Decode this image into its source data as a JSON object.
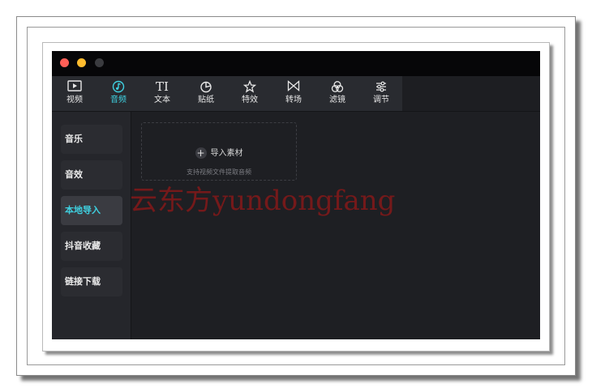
{
  "window": {
    "traffic_lights": [
      {
        "name": "close",
        "color": "#ff5f57"
      },
      {
        "name": "minimize",
        "color": "#febc2e"
      },
      {
        "name": "zoom",
        "color": "#3a3b3f"
      }
    ]
  },
  "toolbar": {
    "items": [
      {
        "label": "视频",
        "icon": "play-box-icon",
        "active": false
      },
      {
        "label": "音频",
        "icon": "music-note-icon",
        "active": true
      },
      {
        "label": "文本",
        "icon": "text-ti-icon",
        "active": false
      },
      {
        "label": "贴纸",
        "icon": "sticker-icon",
        "active": false
      },
      {
        "label": "特效",
        "icon": "sparkle-star-icon",
        "active": false
      },
      {
        "label": "转场",
        "icon": "transition-bowtie-icon",
        "active": false
      },
      {
        "label": "滤镜",
        "icon": "filter-circles-icon",
        "active": false
      },
      {
        "label": "调节",
        "icon": "sliders-icon",
        "active": false
      }
    ],
    "accent_color": "#3fd0e0"
  },
  "sidebar": {
    "items": [
      {
        "label": "音乐",
        "active": false
      },
      {
        "label": "音效",
        "active": false
      },
      {
        "label": "本地导入",
        "active": true
      },
      {
        "label": "抖音收藏",
        "active": false
      },
      {
        "label": "链接下载",
        "active": false
      }
    ]
  },
  "main": {
    "import_label": "导入素材",
    "import_hint": "支持视频文件提取音频"
  },
  "watermark": {
    "text": "云东方yundongfang"
  }
}
